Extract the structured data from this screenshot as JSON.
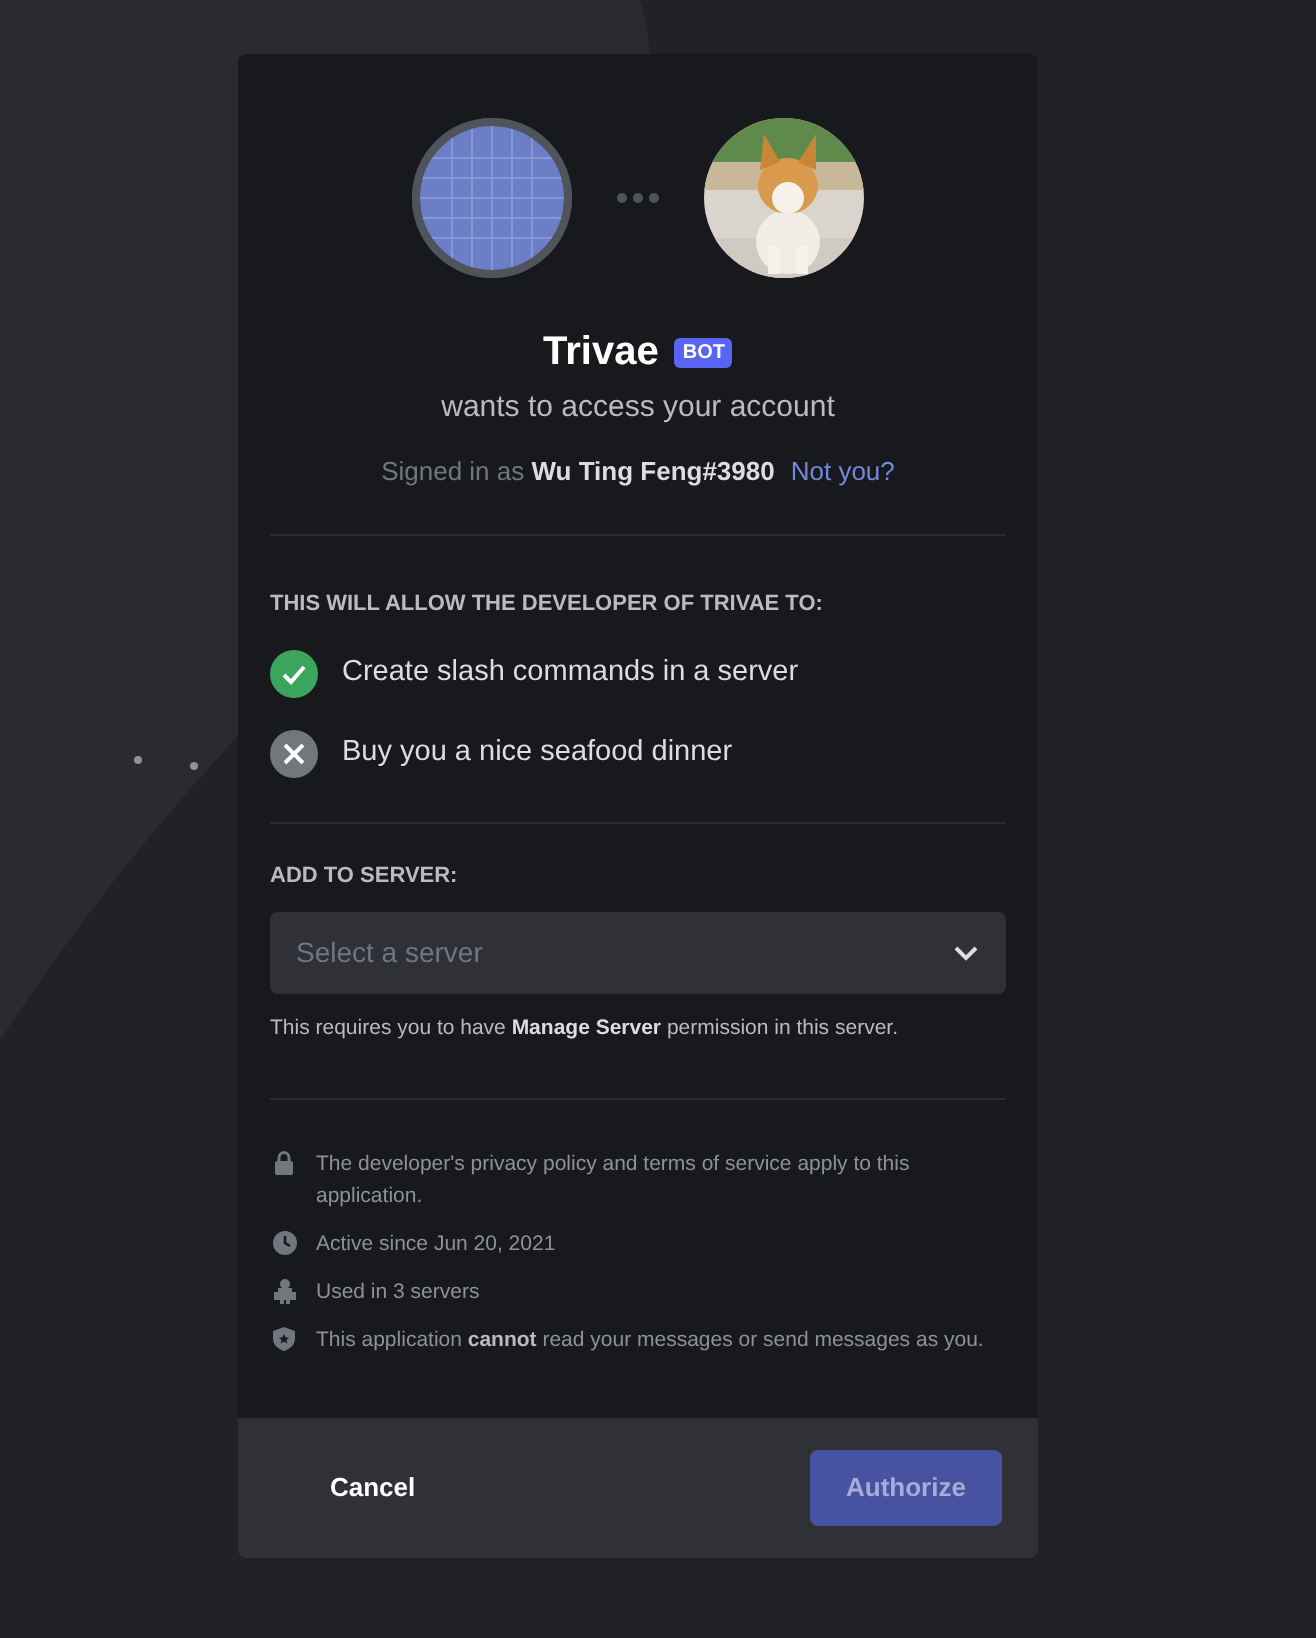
{
  "app": {
    "name": "Trivae",
    "badge": "BOT",
    "subtitle": "wants to access your account"
  },
  "signed_in": {
    "prefix": "Signed in as",
    "user": "Wu Ting Feng#3980",
    "link": "Not you?"
  },
  "permissions": {
    "heading": "THIS WILL ALLOW THE DEVELOPER OF TRIVAE TO:",
    "items": [
      {
        "label": "Create slash commands in a server",
        "allowed": true
      },
      {
        "label": "Buy you a nice seafood dinner",
        "allowed": false
      }
    ]
  },
  "server": {
    "heading": "ADD TO SERVER:",
    "placeholder": "Select a server",
    "note": "This requires you to have **Manage Server** permission in this server."
  },
  "info": [
    {
      "kind": "lock",
      "text": "The developer's privacy policy and terms of service apply to this application."
    },
    {
      "kind": "clock",
      "text": "Active since Jun 20, 2021"
    },
    {
      "kind": "robot",
      "text": "Used in 3 servers"
    },
    {
      "kind": "shield",
      "text": "This application **cannot** read your messages or send messages as you."
    }
  ],
  "buttons": {
    "cancel": "Cancel",
    "authorize": {
      "label": "Authorize",
      "disabled": true
    }
  }
}
